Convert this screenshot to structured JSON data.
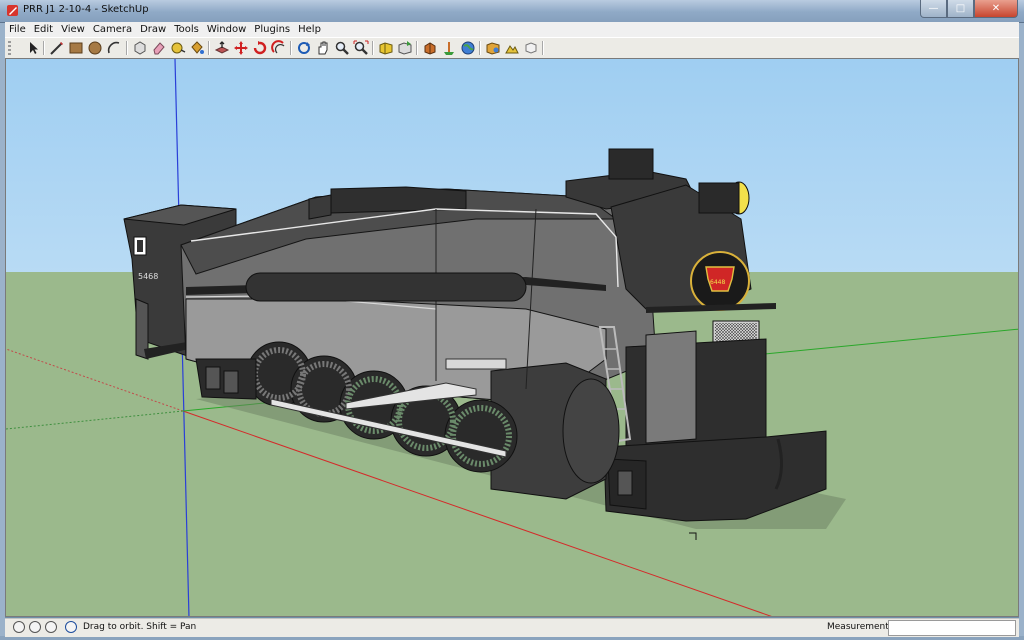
{
  "window": {
    "title": "PRR J1 2-10-4 - SketchUp",
    "controls": [
      "minimize",
      "maximize",
      "close"
    ]
  },
  "menu": [
    "File",
    "Edit",
    "View",
    "Camera",
    "Draw",
    "Tools",
    "Window",
    "Plugins",
    "Help"
  ],
  "toolbar": {
    "tools": [
      "select-icon",
      "line-icon",
      "rectangle-icon",
      "circle-icon",
      "arc-icon",
      "make-component-icon",
      "eraser-icon",
      "tape-measure-icon",
      "paint-bucket-icon",
      "push-pull-icon",
      "move-icon",
      "rotate-icon",
      "offset-icon",
      "orbit-icon",
      "pan-icon",
      "zoom-icon",
      "zoom-extents-icon",
      "get-models-icon",
      "share-model-icon",
      "share-component-icon",
      "place-model-icon",
      "preview-in-google-earth-icon",
      "get-current-view-icon",
      "toggle-terrain-icon",
      "photo-textures-icon",
      "3d-warehouse-icon"
    ]
  },
  "model": {
    "number_plate": "5468",
    "keystone_text": "6448"
  },
  "status": {
    "message": "Drag to orbit.  Shift = Pan",
    "measurements_label": "Measurements",
    "measurements_value": ""
  }
}
